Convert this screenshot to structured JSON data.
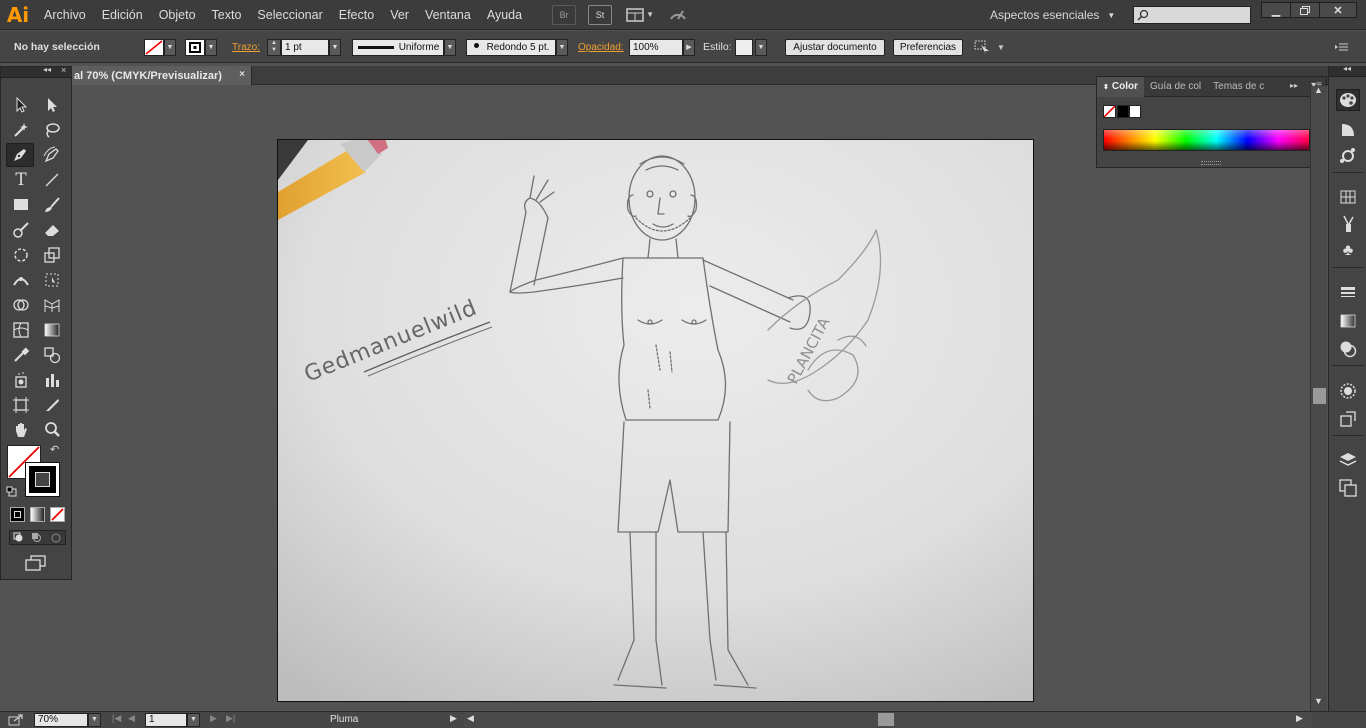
{
  "app": {
    "logo_text": "Ai",
    "menu": [
      "Archivo",
      "Edición",
      "Objeto",
      "Texto",
      "Seleccionar",
      "Efecto",
      "Ver",
      "Ventana",
      "Ayuda"
    ],
    "bridge_label": "Br",
    "stock_label": "St",
    "workspace": "Aspectos esenciales",
    "accent_color": "#ff9a00"
  },
  "control_bar": {
    "selection_status": "No hay selección",
    "stroke_label": "Trazo:",
    "stroke_weight": "1 pt",
    "stroke_profile": "Uniforme",
    "brush": "Redondo 5 pt.",
    "opacity_label": "Opacidad:",
    "opacity": "100%",
    "style_label": "Estilo:",
    "fit_document_button": "Ajustar documento",
    "preferences_button": "Preferencias"
  },
  "document": {
    "tab_title": "al 70% (CMYK/Previsualizar)",
    "close_glyph": "×",
    "sketch_text_1": "Gedmanuelwild",
    "sketch_text_2": "PLANCITA"
  },
  "color_panel": {
    "tabs": [
      "Color",
      "Guía de col",
      "Temas de c"
    ]
  },
  "status_bar": {
    "zoom": "70%",
    "artboard_number": "1",
    "current_tool": "Pluma"
  }
}
